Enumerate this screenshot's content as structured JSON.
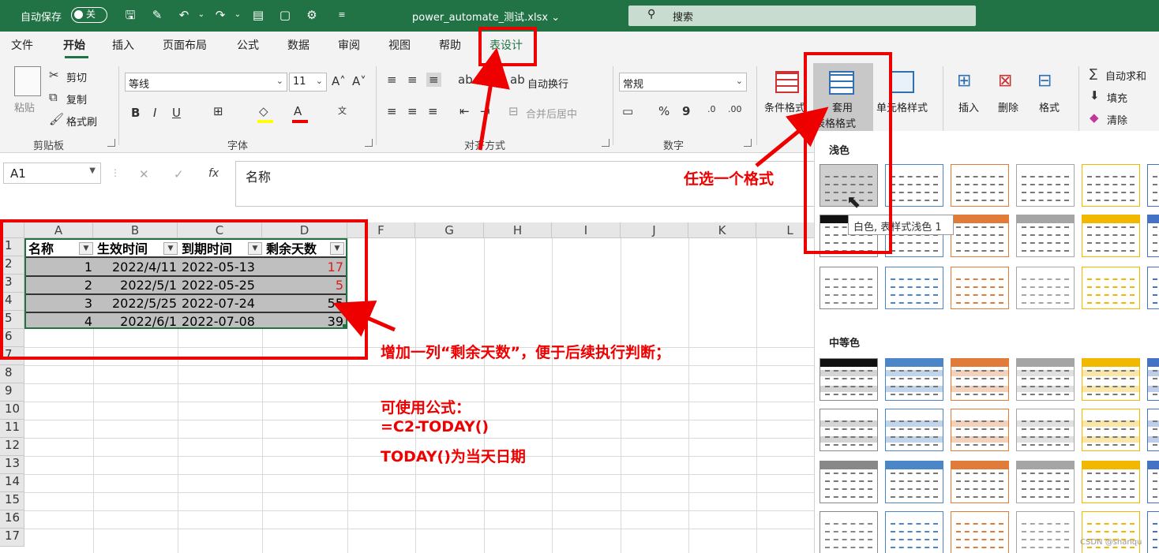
{
  "titlebar": {
    "autosave_label": "自动保存",
    "autosave_state": "关",
    "filename": "power_automate_测试.xlsx ⌄",
    "search_placeholder": "搜索",
    "bg_color": "#217346"
  },
  "tabs": [
    "文件",
    "开始",
    "插入",
    "页面布局",
    "公式",
    "数据",
    "审阅",
    "视图",
    "帮助",
    "表设计"
  ],
  "active_tab": "开始",
  "ribbon": {
    "clipboard": {
      "paste": "粘贴",
      "cut": "剪切",
      "copy": "复制",
      "format_painter": "格式刷",
      "label": "剪贴板"
    },
    "font": {
      "name": "等线",
      "size": "11",
      "bold": "B",
      "italic": "I",
      "underline": "U",
      "label": "字体"
    },
    "alignment": {
      "wrap": "自动换行",
      "merge": "合并后居中",
      "label": "对齐方式"
    },
    "number": {
      "format": "常规",
      "percent": "%",
      "comma": "9",
      "label": "数字"
    },
    "styles": {
      "conditional": "条件格式",
      "format_as_table_1": "套用",
      "format_as_table_2": "表格格式",
      "cell_styles": "单元格样式"
    },
    "cells": {
      "insert": "插入",
      "delete": "删除",
      "format": "格式"
    },
    "editing": {
      "autosum": "自动求和",
      "fill": "填充",
      "clear": "清除"
    }
  },
  "formula_bar": {
    "name_box": "A1",
    "cancel": "✕",
    "enter": "✓",
    "fx": "fx",
    "content": "名称"
  },
  "grid": {
    "columns": [
      "A",
      "B",
      "C",
      "D",
      "F",
      "G",
      "H",
      "I",
      "J",
      "K",
      "L"
    ],
    "rows": [
      "1",
      "2",
      "3",
      "4",
      "5",
      "6",
      "7",
      "8",
      "9",
      "10",
      "11",
      "12",
      "13",
      "14",
      "15",
      "16",
      "17"
    ],
    "table_headers": [
      "名称",
      "生效时间",
      "到期时间",
      "剩余天数"
    ],
    "table_rows": [
      [
        "1",
        "2022/4/11",
        "2022-05-13",
        "17"
      ],
      [
        "2",
        "2022/5/1",
        "2022-05-25",
        "5"
      ],
      [
        "3",
        "2022/5/25",
        "2022-07-24",
        "55"
      ],
      [
        "4",
        "2022/6/1",
        "2022-07-08",
        "39"
      ]
    ],
    "red_value_color": "#d82020"
  },
  "gallery": {
    "light_label": "浅色",
    "medium_label": "中等色",
    "tooltip": "白色, 表样式浅色 1",
    "accent_colors": [
      "#888888",
      "#4a86c8",
      "#e07b39",
      "#a5a5a5",
      "#f2b800",
      "#4472c4"
    ]
  },
  "annotations": {
    "choose_format": "任选一个格式",
    "add_column": "增加一列“剩余天数”，便于后续执行判断；",
    "formula_intro": "可使用公式：",
    "formula": "=C2-TODAY()",
    "today_note": "TODAY()为当天日期",
    "color": "#e00000"
  },
  "watermark": "CSDN @shanqu"
}
